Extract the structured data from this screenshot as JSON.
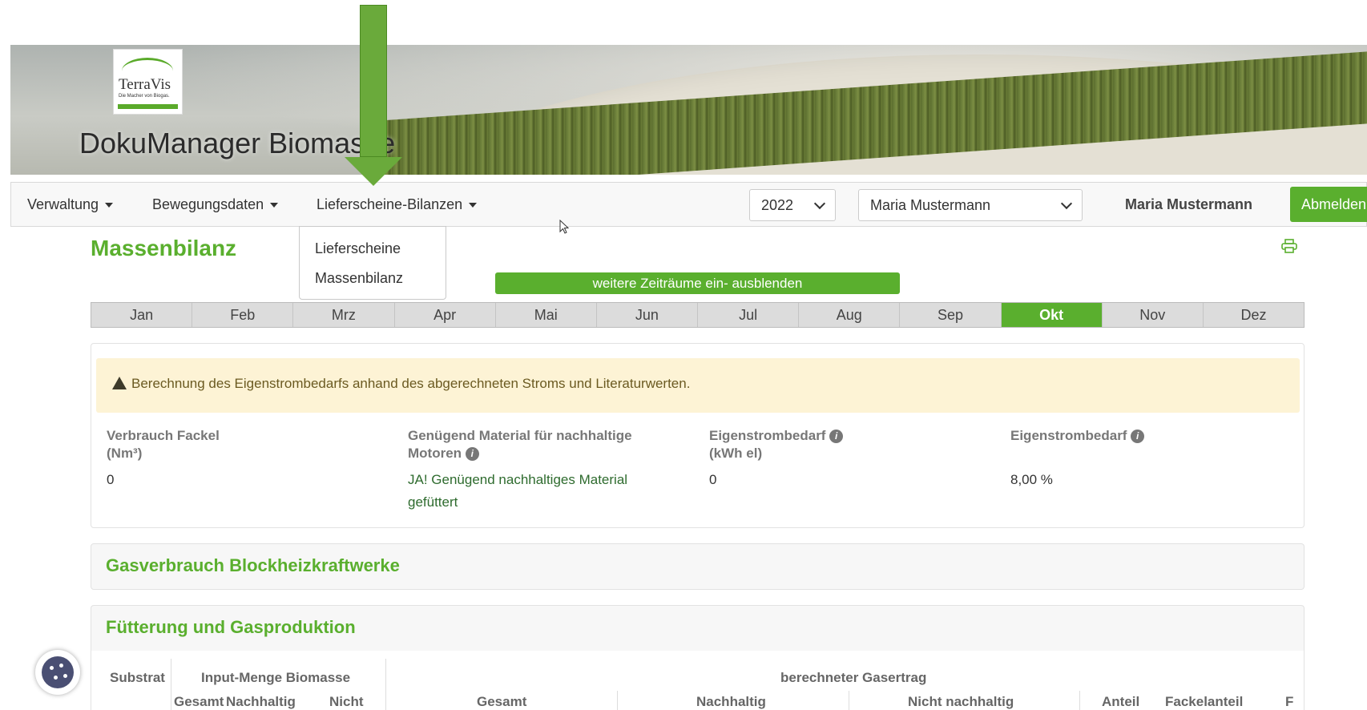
{
  "header": {
    "logo_text": "TerraVis",
    "logo_tagline": "Die Macher von Biogas.",
    "app_title": "DokuManager Biomasse"
  },
  "navbar": {
    "items": [
      {
        "label": "Verwaltung"
      },
      {
        "label": "Bewegungsdaten"
      },
      {
        "label": "Lieferscheine-Bilanzen"
      }
    ],
    "year_select": "2022",
    "user_select": "Maria Mustermann",
    "user_name": "Maria Mustermann",
    "logout_label": "Abmelden"
  },
  "dropdown": {
    "items": [
      "Lieferscheine",
      "Massenbilanz"
    ]
  },
  "page": {
    "title": "Massenbilanz",
    "toggle_label": "weitere Zeiträume ein- ausblenden"
  },
  "months": {
    "items": [
      "Jan",
      "Feb",
      "Mrz",
      "Apr",
      "Mai",
      "Jun",
      "Jul",
      "Aug",
      "Sep",
      "Okt",
      "Nov",
      "Dez"
    ],
    "active": "Okt"
  },
  "info": {
    "alert": "Berechnung des Eigenstrombedarfs anhand des abgerechneten Stroms und Literaturwerten.",
    "columns": [
      {
        "head1": "Verbrauch Fackel",
        "head2": "(Nm³)",
        "value": "0"
      },
      {
        "head1": "Genügend Material für nachhaltige",
        "head2": "Motoren",
        "value1": "JA! Genügend nachhaltiges Material",
        "value2": "gefüttert"
      },
      {
        "head1": "Eigenstrombedarf",
        "head2": "(kWh el)",
        "value": "0"
      },
      {
        "head1": "Eigenstrombedarf",
        "value": "8,00 %"
      }
    ]
  },
  "sections": {
    "gas": "Gasverbrauch Blockheizkraftwerke",
    "feed": "Fütterung und Gasproduktion"
  },
  "table": {
    "substrat": "Substrat",
    "input": "Input-Menge Biomasse",
    "gasertrag": "berechneter Gasertrag",
    "sub_gesamt": "Gesamt",
    "sub_nachhaltig": "Nachhaltig",
    "sub_nicht": "Nicht",
    "col_gesamt": "Gesamt",
    "col_nachhaltig": "Nachhaltig",
    "col_nicht": "Nicht nachhaltig",
    "col_anteil": "Anteil",
    "col_fackel": "Fackelanteil",
    "col_f": "F"
  }
}
